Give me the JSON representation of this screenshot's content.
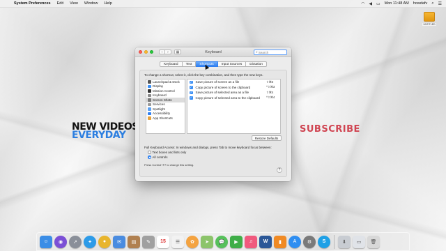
{
  "menubar": {
    "app_name": "System Preferences",
    "menus": [
      "Edit",
      "View",
      "Window",
      "Help"
    ],
    "clock": "Mon 11:48 AM",
    "user": "howdafv"
  },
  "desktop": {
    "drive_label": "UNTITLED",
    "promo_line1": "NEW VIDEOS",
    "promo_line2": "EVERYDAY",
    "promo_subscribe": "SUBSCRIBE"
  },
  "window": {
    "title": "Keyboard",
    "search_placeholder": "Search",
    "tabs": [
      {
        "label": "Keyboard",
        "active": false
      },
      {
        "label": "Text",
        "active": false
      },
      {
        "label": "Shortcuts",
        "active": true
      },
      {
        "label": "Input Sources",
        "active": false
      },
      {
        "label": "Dictation",
        "active": false
      }
    ],
    "instructions": "To change a shortcut, select it, click the key combination, and then type the new keys.",
    "categories": [
      {
        "label": "Launchpad & Dock",
        "color": "#555555"
      },
      {
        "label": "Display",
        "color": "#3a8ff5"
      },
      {
        "label": "Mission Control",
        "color": "#333333"
      },
      {
        "label": "Keyboard",
        "color": "#888888"
      },
      {
        "label": "Screen Shots",
        "color": "#777777",
        "selected": true
      },
      {
        "label": "Services",
        "color": "#999999"
      },
      {
        "label": "Spotlight",
        "color": "#5aa0f2"
      },
      {
        "label": "Accessibility",
        "color": "#2f7ff1"
      },
      {
        "label": "App Shortcuts",
        "color": "#e6a23c"
      }
    ],
    "shortcuts": [
      {
        "label": "Save picture of screen as a file",
        "key": "⇧⌘3"
      },
      {
        "label": "Copy picture of screen to the clipboard",
        "key": "^⇧⌘3"
      },
      {
        "label": "Save picture of selected area as a file",
        "key": "⇧⌘4"
      },
      {
        "label": "Copy picture of selected area to the clipboard",
        "key": "^⇧⌘4"
      }
    ],
    "restore_label": "Restore Defaults",
    "kb_access": "Full Keyboard Access: In windows and dialogs, press Tab to move keyboard focus between:",
    "radio_text_boxes": "Text boxes and lists only",
    "radio_all_controls": "All controls",
    "hint": "Press Control+F7 to change this setting.",
    "help": "?"
  },
  "dock": {
    "icons": [
      {
        "name": "finder-icon",
        "color": "#3b8de6"
      },
      {
        "name": "siri-icon",
        "color": "#7b4fd6"
      },
      {
        "name": "launchpad-icon",
        "color": "#8a8f99"
      },
      {
        "name": "safari-icon",
        "color": "#2d9be8"
      },
      {
        "name": "chrome-icon",
        "color": "#e8b52d"
      },
      {
        "name": "mail-icon",
        "color": "#4a8ce0"
      },
      {
        "name": "contacts-icon",
        "color": "#b08050"
      },
      {
        "name": "notes-icon",
        "color": "#a0a0a0"
      },
      {
        "name": "calendar-icon",
        "color": "#ffffff"
      },
      {
        "name": "reminders-icon",
        "color": "#f2f2f2"
      },
      {
        "name": "photos-icon",
        "color": "#f4a340"
      },
      {
        "name": "maps-icon",
        "color": "#8cc46a"
      },
      {
        "name": "messages-icon",
        "color": "#57c15b"
      },
      {
        "name": "facetime-icon",
        "color": "#3fae48"
      },
      {
        "name": "music-icon",
        "color": "#f05a7e"
      },
      {
        "name": "word-icon",
        "color": "#2b5797"
      },
      {
        "name": "books-icon",
        "color": "#f08a24"
      },
      {
        "name": "appstore-icon",
        "color": "#2f8ef1"
      },
      {
        "name": "system-preferences-icon",
        "color": "#7a7a7a"
      },
      {
        "name": "skype-icon",
        "color": "#1ea0e6"
      },
      {
        "name": "downloads-icon",
        "color": "#c8ccd2"
      },
      {
        "name": "documents-icon",
        "color": "#e0e3e8"
      },
      {
        "name": "trash-icon",
        "color": "#d8d8d8"
      }
    ],
    "calendar_day": "15"
  }
}
